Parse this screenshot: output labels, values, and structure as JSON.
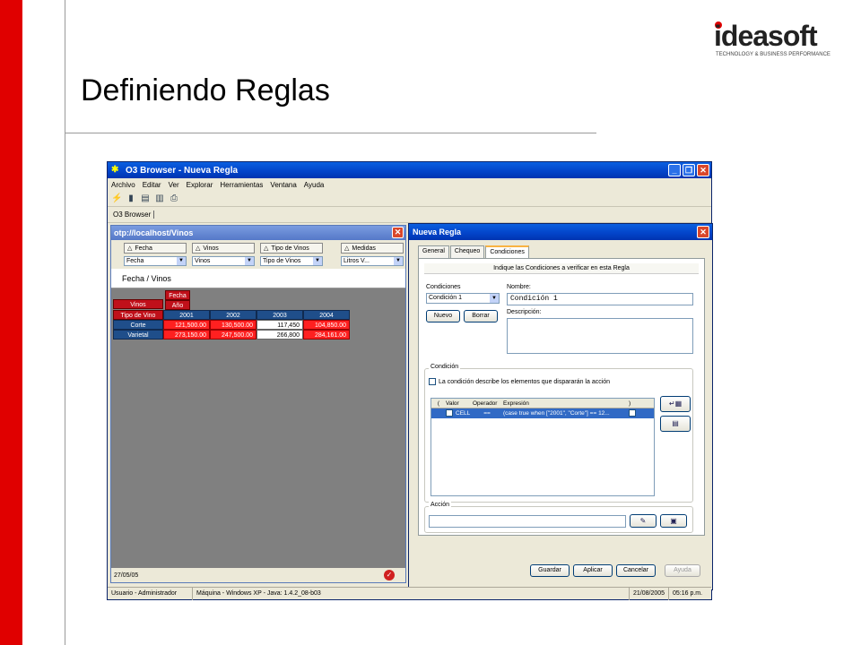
{
  "slide": {
    "title": "Definiendo Reglas",
    "logo_text": "ideasoft",
    "logo_tagline": "TECHNOLOGY & BUSINESS PERFORMANCE",
    "accent_color": "#e00000"
  },
  "app": {
    "title": "O3 Browser - Nueva Regla",
    "menu": [
      "Archivo",
      "Editar",
      "Ver",
      "Explorar",
      "Herramientas",
      "Ventana",
      "Ayuda"
    ],
    "tab": "O3 Browser",
    "status": {
      "user": "Usuario - Administrador",
      "machine": "Máquina - Windows XP - Java: 1.4.2_08-b03",
      "date": "21/08/2005",
      "time": "05:16 p.m."
    }
  },
  "cube_window": {
    "title": "otp://localhost/Vinos",
    "dimensions": [
      {
        "header": "Fecha",
        "value": "Fecha"
      },
      {
        "header": "Vinos",
        "value": "Vinos"
      },
      {
        "header": "Tipo de Vinos",
        "value": "Tipo de Vinos"
      },
      {
        "header": "Medidas",
        "value": "Litros V..."
      }
    ],
    "view_label": "Fecha / Vinos",
    "pivot": {
      "col_dim": "Fecha",
      "col_sub": "Año",
      "row_dim": "Vinos",
      "row_sub": "Tipo de Vino",
      "years": [
        "2001",
        "2002",
        "2003",
        "2004"
      ],
      "rows": [
        {
          "label": "Corte",
          "values": [
            "121,500.00",
            "130,500.00",
            "117,450",
            "104,850.00"
          ]
        },
        {
          "label": "Varietal",
          "values": [
            "273,150.00",
            "247,500.00",
            "266,800",
            "284,161.00"
          ]
        }
      ]
    },
    "status_date": "27/05/05"
  },
  "rule_dialog": {
    "title": "Nueva Regla",
    "tabs": [
      "General",
      "Chequeo",
      "Condiciones"
    ],
    "panel_title": "Indique las Condiciones a verificar en esta Regla",
    "condiciones_label": "Condiciones",
    "condiciones_value": "Condición 1",
    "nombre_label": "Nombre:",
    "nombre_value": "Condición 1",
    "nuevo_label": "Nuevo",
    "borrar_label": "Borrar",
    "descripcion_label": "Descripción:",
    "condicion_group": "Condición",
    "checkbox_label": "La condición describe los elementos que dispararán la acción",
    "table_headers": [
      "(",
      "Valor",
      "Operador",
      "Expresión",
      ")"
    ],
    "table_row": {
      "valor": "CELL",
      "operador": "==",
      "expresion": "(case true when [\"2001\", \"Corte\"] == 12..."
    },
    "accion_group": "Acción",
    "buttons": [
      "Guardar",
      "Aplicar",
      "Cancelar",
      "Ayuda"
    ]
  }
}
